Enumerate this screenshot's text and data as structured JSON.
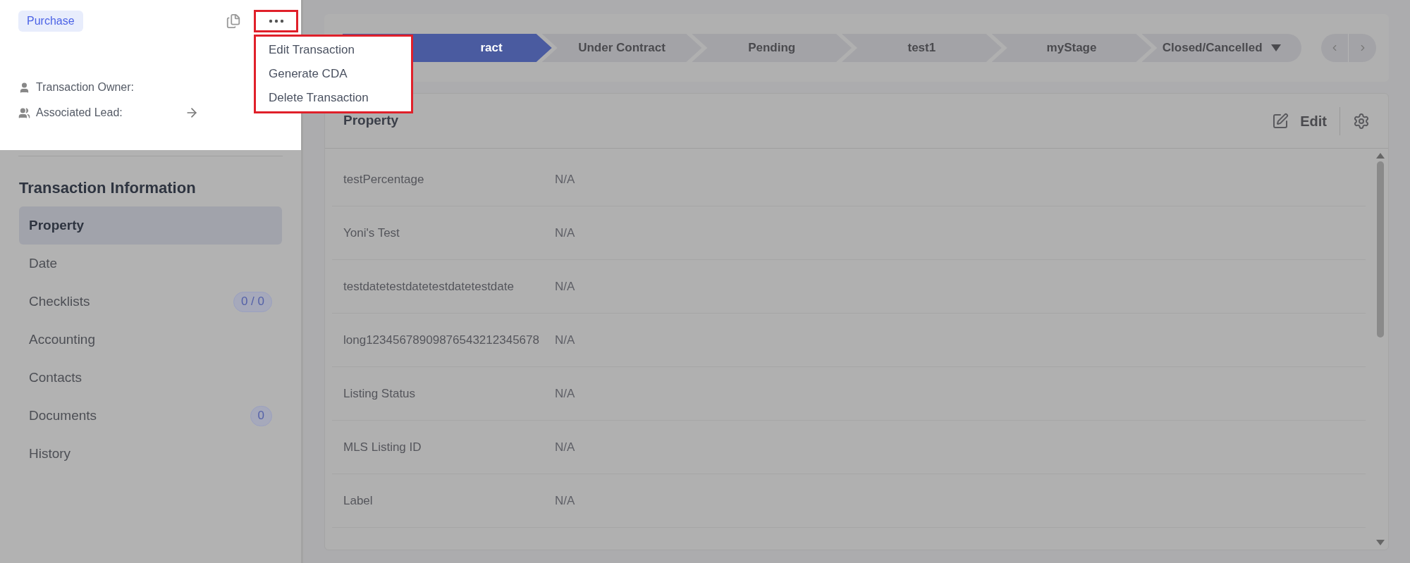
{
  "header": {
    "tag": "Purchase",
    "owner_label": "Transaction Owner:",
    "lead_label": "Associated Lead:"
  },
  "menu": {
    "items": [
      "Edit Transaction",
      "Generate CDA",
      "Delete Transaction"
    ]
  },
  "sidebar": {
    "title": "Transaction Information",
    "items": [
      {
        "label": "Property",
        "selected": true
      },
      {
        "label": "Date",
        "selected": false
      },
      {
        "label": "Checklists",
        "selected": false,
        "badge": "0 / 0"
      },
      {
        "label": "Accounting",
        "selected": false
      },
      {
        "label": "Contacts",
        "selected": false
      },
      {
        "label": "Documents",
        "selected": false,
        "badge": "0"
      },
      {
        "label": "History",
        "selected": false
      }
    ]
  },
  "stages": [
    {
      "label": "ract",
      "selected": true,
      "kind": "step"
    },
    {
      "label": "Under Contract",
      "selected": false,
      "kind": "step"
    },
    {
      "label": "Pending",
      "selected": false,
      "kind": "step"
    },
    {
      "label": "test1",
      "selected": false,
      "kind": "step"
    },
    {
      "label": "myStage",
      "selected": false,
      "kind": "step"
    },
    {
      "label": "Closed/Cancelled",
      "selected": false,
      "kind": "dropdown"
    }
  ],
  "property": {
    "title": "Property",
    "edit": "Edit",
    "rows": [
      {
        "label": "testPercentage",
        "value": "N/A"
      },
      {
        "label": "Yoni's Test",
        "value": "N/A"
      },
      {
        "label": "testdatetestdatetestdatetestdate",
        "value": "N/A"
      },
      {
        "label": "long12345678909876543212345678",
        "value": "N/A"
      },
      {
        "label": "Listing Status",
        "value": "N/A"
      },
      {
        "label": "MLS Listing ID",
        "value": "N/A"
      },
      {
        "label": "Label",
        "value": "N/A"
      }
    ]
  }
}
